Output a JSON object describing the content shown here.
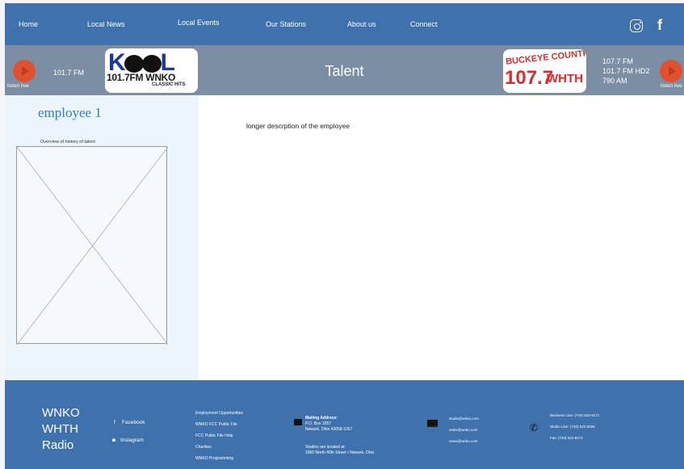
{
  "nav": {
    "items": [
      "Home",
      "Local News",
      "Local Events",
      "Our Stations",
      "About us",
      "Connect"
    ],
    "instagram_icon": "instagram-icon",
    "facebook_icon": "facebook-icon"
  },
  "station_bar": {
    "title": "Talent",
    "left": {
      "listen_label": "listen live",
      "frequency": "101.7 FM",
      "logo": {
        "brand": "KOOL",
        "freq_text": "101.7FM  WNKO",
        "tagline": "CLASSIC HITS"
      }
    },
    "right": {
      "listen_label": "listen live",
      "frequencies": [
        "107.7 FM",
        "101.7 FM HD2",
        "790 AM"
      ],
      "logo": {
        "top_text": "BUCKEYE COUNTRY",
        "freq_text": "107.7",
        "call_letters": "WHTH"
      }
    }
  },
  "employee": {
    "name": "employee 1",
    "overview_label": "Overview of history of talent",
    "description": "longer descrption of the employee"
  },
  "footer": {
    "brand_lines": [
      "WNKO",
      "WHTH",
      "Radio"
    ],
    "social": [
      {
        "icon": "facebook-icon",
        "label": "Facebook"
      },
      {
        "icon": "instagram-icon",
        "label": "Instagram"
      }
    ],
    "links": [
      "Employment Opportunities",
      "WNKO FCC Public File",
      "FCC Public File Help",
      "Charities",
      "WNKO Programming"
    ],
    "mailing": {
      "heading": "Mailing Address:",
      "lines": [
        "P.O. Box 1057",
        "Newark, Ohio 43058-1057"
      ],
      "studios_heading": "Studios are located at:",
      "studios_line": "1000 North 40th Street • Newark, Ohio"
    },
    "emails": [
      "studio@wnko.com",
      "sales@wnko.com",
      "news@wnko.com"
    ],
    "phones": [
      "Business Line: (740) 522-8171",
      "Studio Line: (740) 522-8285",
      "Fax: (740) 522-8174"
    ]
  },
  "colors": {
    "nav_bg": "#3f71ac",
    "bar_bg": "#7c8ea3",
    "accent_title": "#2b7fc8",
    "play_button": "#e0522f"
  }
}
